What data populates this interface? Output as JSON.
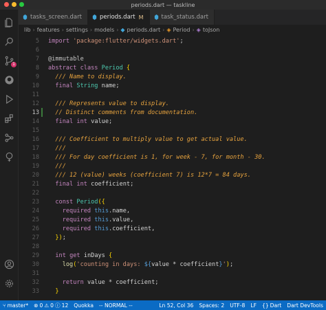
{
  "window": {
    "title": "periods.dart — taskline"
  },
  "colors": {
    "accent": "#0b6bc4",
    "comment": "#e7a33e",
    "keyword": "#c586c0",
    "string": "#ce9178"
  },
  "tabs": [
    {
      "label": "tasks_screen.dart",
      "modified": ""
    },
    {
      "label": "periods.dart",
      "modified": "M"
    },
    {
      "label": "task_status.dart",
      "modified": ""
    }
  ],
  "breadcrumb": [
    "lib",
    "features",
    "settings",
    "models",
    "periods.dart",
    "Period",
    "toJson"
  ],
  "activity_bar": {
    "items": [
      "files-icon",
      "search-icon",
      "source-control-icon",
      "github-icon",
      "run-debug-icon",
      "extensions-icon",
      "remote-explorer-icon",
      "tree-icon"
    ],
    "source_control_badge": "1",
    "bottom": [
      "account-icon",
      "settings-gear-icon"
    ]
  },
  "editor": {
    "current_line": "13",
    "lines": [
      {
        "n": "5",
        "code": "import 'package:flutter/widgets.dart';"
      },
      {
        "n": "6",
        "code": ""
      },
      {
        "n": "7",
        "code": "@immutable"
      },
      {
        "n": "8",
        "code": "abstract class Period {"
      },
      {
        "n": "9",
        "code": "  /// Name to display."
      },
      {
        "n": "10",
        "code": "  final String name;"
      },
      {
        "n": "11",
        "code": ""
      },
      {
        "n": "12",
        "code": "  /// Represents value to display."
      },
      {
        "n": "13",
        "code": "  // Distinct comments from documentation."
      },
      {
        "n": "14",
        "code": "  final int value;"
      },
      {
        "n": "15",
        "code": ""
      },
      {
        "n": "16",
        "code": "  /// Coefficient to multiply value to get actual value."
      },
      {
        "n": "17",
        "code": "  ///"
      },
      {
        "n": "18",
        "code": "  /// For day coefficient is 1, for week - 7, for month - 30."
      },
      {
        "n": "19",
        "code": "  ///"
      },
      {
        "n": "20",
        "code": "  /// 12 (value) weeks (coefficient 7) is 12*7 = 84 days."
      },
      {
        "n": "21",
        "code": "  final int coefficient;"
      },
      {
        "n": "22",
        "code": ""
      },
      {
        "n": "23",
        "code": "  const Period({"
      },
      {
        "n": "24",
        "code": "    required this.name,"
      },
      {
        "n": "25",
        "code": "    required this.value,"
      },
      {
        "n": "26",
        "code": "    required this.coefficient,"
      },
      {
        "n": "27",
        "code": "  });"
      },
      {
        "n": "28",
        "code": ""
      },
      {
        "n": "29",
        "code": "  int get inDays {"
      },
      {
        "n": "30",
        "code": "    log('counting in days: ${value * coefficient}');"
      },
      {
        "n": "31",
        "code": ""
      },
      {
        "n": "32",
        "code": "    return value * coefficient;"
      },
      {
        "n": "33",
        "code": "  }"
      }
    ]
  },
  "statusbar": {
    "branch": "master*",
    "errors": "0",
    "warnings": "0",
    "infos": "12",
    "quokka": "Quokka",
    "mode": "-- NORMAL --",
    "position": "Ln 52, Col 36",
    "spaces": "Spaces: 2",
    "encoding": "UTF-8",
    "eol": "LF",
    "language": "Dart",
    "devtools": "Dart DevTools"
  }
}
